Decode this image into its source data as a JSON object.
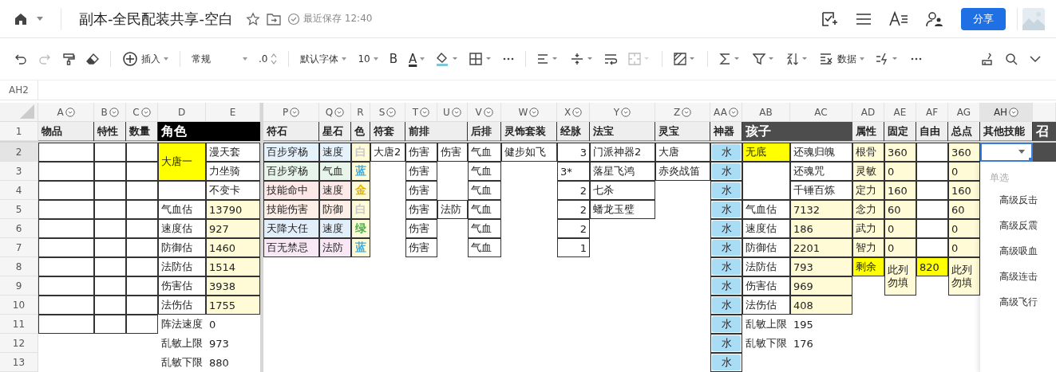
{
  "header": {
    "title": "副本-全民配装共享-空白",
    "save_status": "最近保存 12:40",
    "share": "分享"
  },
  "toolbar": {
    "redo": {
      "disabled": true
    },
    "insert": "插入",
    "number_format": "常规",
    "decimals": ".0",
    "font": "默认字体",
    "font_size": "10",
    "bold": "B",
    "font_color": "A",
    "merge": {
      "disabled": true
    },
    "data": "数据"
  },
  "name_box": "AH2",
  "columns": [
    {
      "letter": "A",
      "filter": true,
      "selected": false
    },
    {
      "letter": "B",
      "filter": true,
      "selected": false
    },
    {
      "letter": "C",
      "filter": true,
      "selected": false
    },
    {
      "letter": "D",
      "filter": false,
      "selected": false
    },
    {
      "letter": "E",
      "filter": false,
      "selected": false
    },
    {
      "letter": "P",
      "filter": true,
      "selected": false
    },
    {
      "letter": "Q",
      "filter": true,
      "selected": false
    },
    {
      "letter": "R",
      "filter": false,
      "selected": false
    },
    {
      "letter": "S",
      "filter": true,
      "selected": false
    },
    {
      "letter": "T",
      "filter": true,
      "selected": false
    },
    {
      "letter": "U",
      "filter": true,
      "selected": false
    },
    {
      "letter": "V",
      "filter": true,
      "selected": false
    },
    {
      "letter": "W",
      "filter": true,
      "selected": false
    },
    {
      "letter": "X",
      "filter": true,
      "selected": false
    },
    {
      "letter": "Y",
      "filter": true,
      "selected": false
    },
    {
      "letter": "Z",
      "filter": true,
      "selected": false
    },
    {
      "letter": "AA",
      "filter": true,
      "selected": false
    },
    {
      "letter": "AB",
      "filter": false,
      "selected": false
    },
    {
      "letter": "AC",
      "filter": false,
      "selected": false
    },
    {
      "letter": "AD",
      "filter": false,
      "selected": false
    },
    {
      "letter": "AE",
      "filter": false,
      "selected": false
    },
    {
      "letter": "AF",
      "filter": false,
      "selected": false
    },
    {
      "letter": "AG",
      "filter": false,
      "selected": false
    },
    {
      "letter": "AH",
      "filter": true,
      "selected": true
    },
    {
      "filter": false,
      "selected": false
    }
  ],
  "rows": [
    {
      "number": "1",
      "selected": false,
      "cells": [
        {
          "kind": "head",
          "text": "物品"
        },
        {
          "kind": "head",
          "text": "特性"
        },
        {
          "kind": "head",
          "text": "数量"
        },
        {
          "kind": "title",
          "text": "角色",
          "color": "#000000",
          "merged_across": true
        },
        {
          "kind": "head",
          "text": "符石"
        },
        {
          "kind": "head",
          "text": "星石"
        },
        {
          "kind": "head",
          "text": "色"
        },
        {
          "kind": "head",
          "text": "符套"
        },
        {
          "kind": "head",
          "text": "前排",
          "merged_across": true
        },
        {
          "kind": "head",
          "text": "后排"
        },
        {
          "kind": "head",
          "text": "灵饰套装"
        },
        {
          "kind": "head",
          "text": "经脉"
        },
        {
          "kind": "head",
          "text": "法宝"
        },
        {
          "kind": "head",
          "text": "灵宝"
        },
        {
          "kind": "head",
          "text": "神器"
        },
        {
          "kind": "title",
          "text": "孩子",
          "color": "#4d4d4d",
          "merged_across": true
        },
        {
          "kind": "head",
          "text": "属性"
        },
        {
          "kind": "head",
          "text": "固定"
        },
        {
          "kind": "head",
          "text": "自由"
        },
        {
          "kind": "head",
          "text": "总点"
        },
        {
          "kind": "head",
          "text": "其他技能"
        },
        {
          "kind": "title",
          "text": "召",
          "color": "#4d4d4d"
        }
      ]
    },
    {
      "number": "2",
      "selected": true,
      "cells": [
        {
          "kind": "cell"
        },
        {
          "kind": "cell"
        },
        {
          "kind": "cell"
        },
        {
          "kind": "cell",
          "text": "大唐一",
          "color": "#ffff00",
          "merged_down": true
        },
        {
          "kind": "cell",
          "text": "漫天套"
        },
        {
          "kind": "cell",
          "text": "百步穿杨",
          "color": "#e5f1fb"
        },
        {
          "kind": "cell",
          "text": "速度",
          "color": "#e5f1fb"
        },
        {
          "kind": "colored_text",
          "text": "白",
          "color": "#c8c8c8"
        },
        {
          "kind": "cell",
          "text": "大唐2"
        },
        {
          "kind": "cell",
          "text": "伤害"
        },
        {
          "kind": "cell",
          "text": "伤害"
        },
        {
          "kind": "cell",
          "text": "气血"
        },
        {
          "kind": "cell",
          "text": "健步如飞"
        },
        {
          "kind": "cell",
          "text": "3",
          "right_aligned": true
        },
        {
          "kind": "cell",
          "text": "门派神器2"
        },
        {
          "kind": "cell",
          "text": "大唐"
        },
        {
          "kind": "tag",
          "text": "水",
          "color": "#a9dcf5"
        },
        {
          "kind": "cell",
          "text": "无底",
          "color": "#ffff00"
        },
        {
          "kind": "cell",
          "text": "还魂归魄"
        },
        {
          "kind": "cell",
          "text": "根骨",
          "color": "#fffbd6"
        },
        {
          "kind": "cell",
          "text": "360",
          "color": "#fffbd6"
        },
        {
          "kind": "cell"
        },
        {
          "kind": "cell",
          "text": "360",
          "color": "#fffbd6"
        },
        {
          "kind": "select"
        },
        {
          "kind": "title",
          "color": "#4d4d4d"
        }
      ]
    },
    {
      "number": "3",
      "selected": false,
      "cells": [
        {
          "kind": "cell"
        },
        {
          "kind": "cell"
        },
        {
          "kind": "cell"
        },
        {
          "kind": "cell",
          "text": "力坐骑"
        },
        {
          "kind": "cell",
          "text": "百步穿杨",
          "color": "#e8f5ea"
        },
        {
          "kind": "cell",
          "text": "气血",
          "color": "#e8f5ea"
        },
        {
          "kind": "colored_text",
          "text": "蓝",
          "color": "#3fa9e0"
        },
        {
          "kind": "free"
        },
        {
          "kind": "cell",
          "text": "伤害"
        },
        {
          "kind": "free"
        },
        {
          "kind": "cell",
          "text": "气血"
        },
        {
          "kind": "free"
        },
        {
          "kind": "cell",
          "text": "3*"
        },
        {
          "kind": "cell",
          "text": "落星飞鸿"
        },
        {
          "kind": "cell",
          "text": "赤炎战笛"
        },
        {
          "kind": "tag",
          "text": "水",
          "color": "#a9dcf5"
        },
        {
          "kind": "cell",
          "merged_down": true
        },
        {
          "kind": "cell",
          "text": "还魂咒"
        },
        {
          "kind": "cell",
          "text": "灵敏",
          "color": "#fffbd6"
        },
        {
          "kind": "cell",
          "text": "0",
          "color": "#fffbd6"
        },
        {
          "kind": "cell"
        },
        {
          "kind": "cell",
          "text": "0",
          "color": "#fffbd6"
        }
      ]
    },
    {
      "number": "4",
      "selected": false,
      "cells": [
        {
          "kind": "cell"
        },
        {
          "kind": "cell"
        },
        {
          "kind": "cell"
        },
        {
          "kind": "cell"
        },
        {
          "kind": "cell",
          "text": "不变卡"
        },
        {
          "kind": "cell",
          "text": "技能命中",
          "color": "#fce8e6"
        },
        {
          "kind": "cell",
          "text": "速度",
          "color": "#fce8e6"
        },
        {
          "kind": "colored_text",
          "text": "金",
          "color": "#e6b400"
        },
        {
          "kind": "free"
        },
        {
          "kind": "cell",
          "text": "伤害"
        },
        {
          "kind": "free"
        },
        {
          "kind": "cell",
          "text": "气血"
        },
        {
          "kind": "free"
        },
        {
          "kind": "cell",
          "text": "2",
          "right_aligned": true
        },
        {
          "kind": "cell",
          "text": "七杀"
        },
        {
          "kind": "free"
        },
        {
          "kind": "tag",
          "text": "水",
          "color": "#a9dcf5"
        },
        {
          "kind": "cell",
          "text": "千锤百炼"
        },
        {
          "kind": "cell",
          "text": "定力",
          "color": "#fffbd6"
        },
        {
          "kind": "cell",
          "text": "160",
          "color": "#fffbd6"
        },
        {
          "kind": "cell"
        },
        {
          "kind": "cell",
          "text": "160",
          "color": "#fffbd6"
        }
      ]
    },
    {
      "number": "5",
      "selected": false,
      "cells": [
        {
          "kind": "cell"
        },
        {
          "kind": "cell"
        },
        {
          "kind": "cell"
        },
        {
          "kind": "cell",
          "text": "气血估"
        },
        {
          "kind": "cell",
          "text": "13790",
          "color": "#fffbd6"
        },
        {
          "kind": "cell",
          "text": "技能伤害",
          "color": "#fdeee8"
        },
        {
          "kind": "cell",
          "text": "防御",
          "color": "#fdeee8"
        },
        {
          "kind": "colored_text",
          "text": "白",
          "color": "#c8c8c8"
        },
        {
          "kind": "free"
        },
        {
          "kind": "cell",
          "text": "伤害"
        },
        {
          "kind": "cell",
          "text": "法防"
        },
        {
          "kind": "cell",
          "text": "气血"
        },
        {
          "kind": "free"
        },
        {
          "kind": "cell",
          "text": "2",
          "right_aligned": true
        },
        {
          "kind": "cell",
          "text": "蟠龙玉璧"
        },
        {
          "kind": "free"
        },
        {
          "kind": "tag",
          "text": "水",
          "color": "#a9dcf5"
        },
        {
          "kind": "cell",
          "text": "气血估"
        },
        {
          "kind": "cell",
          "text": "7132",
          "color": "#fffbd6"
        },
        {
          "kind": "cell",
          "text": "念力",
          "color": "#fffbd6"
        },
        {
          "kind": "cell",
          "text": "60",
          "color": "#fffbd6"
        },
        {
          "kind": "cell"
        },
        {
          "kind": "cell",
          "text": "60",
          "color": "#fffbd6"
        }
      ]
    },
    {
      "number": "6",
      "selected": false,
      "cells": [
        {
          "kind": "cell"
        },
        {
          "kind": "cell"
        },
        {
          "kind": "cell"
        },
        {
          "kind": "cell",
          "text": "速度估"
        },
        {
          "kind": "cell",
          "text": "927",
          "color": "#fffbd6"
        },
        {
          "kind": "cell",
          "text": "天降大任",
          "color": "#e3eefb"
        },
        {
          "kind": "cell",
          "text": "速度",
          "color": "#e3eefb"
        },
        {
          "kind": "colored_text",
          "text": "绿",
          "color": "#4caf50"
        },
        {
          "kind": "free"
        },
        {
          "kind": "cell",
          "text": "伤害"
        },
        {
          "kind": "free"
        },
        {
          "kind": "cell",
          "text": "气血"
        },
        {
          "kind": "free"
        },
        {
          "kind": "cell",
          "text": "2",
          "right_aligned": true
        },
        {
          "kind": "free"
        },
        {
          "kind": "free"
        },
        {
          "kind": "tag",
          "text": "水",
          "color": "#a9dcf5"
        },
        {
          "kind": "cell",
          "text": "速度估"
        },
        {
          "kind": "cell",
          "text": "186",
          "color": "#fffbd6"
        },
        {
          "kind": "cell",
          "text": "武力",
          "color": "#fffbd6"
        },
        {
          "kind": "cell",
          "text": "0",
          "color": "#fffbd6"
        },
        {
          "kind": "cell"
        },
        {
          "kind": "cell",
          "text": "0",
          "color": "#fffbd6"
        }
      ]
    },
    {
      "number": "7",
      "selected": false,
      "cells": [
        {
          "kind": "cell"
        },
        {
          "kind": "cell"
        },
        {
          "kind": "cell"
        },
        {
          "kind": "cell",
          "text": "防御估"
        },
        {
          "kind": "cell",
          "text": "1460",
          "color": "#fffbd6"
        },
        {
          "kind": "cell",
          "text": "百无禁忌",
          "color": "#f8e8f6"
        },
        {
          "kind": "cell",
          "text": "法防",
          "color": "#f8e8f6"
        },
        {
          "kind": "colored_text",
          "text": "蓝",
          "color": "#3fa9e0"
        },
        {
          "kind": "free"
        },
        {
          "kind": "cell",
          "text": "伤害"
        },
        {
          "kind": "free"
        },
        {
          "kind": "cell",
          "text": "气血"
        },
        {
          "kind": "free"
        },
        {
          "kind": "cell",
          "text": "1",
          "right_aligned": true
        },
        {
          "kind": "free"
        },
        {
          "kind": "free"
        },
        {
          "kind": "tag",
          "text": "水",
          "color": "#a9dcf5"
        },
        {
          "kind": "cell",
          "text": "防御估"
        },
        {
          "kind": "cell",
          "text": "2201",
          "color": "#fffbd6"
        },
        {
          "kind": "cell",
          "text": "智力",
          "color": "#fffbd6"
        },
        {
          "kind": "cell",
          "text": "0",
          "color": "#fffbd6"
        },
        {
          "kind": "cell"
        },
        {
          "kind": "cell",
          "text": "0",
          "color": "#fffbd6"
        }
      ]
    },
    {
      "number": "8",
      "selected": false,
      "cells": [
        {
          "kind": "cell"
        },
        {
          "kind": "cell"
        },
        {
          "kind": "cell"
        },
        {
          "kind": "cell",
          "text": "法防估"
        },
        {
          "kind": "cell",
          "text": "1514",
          "color": "#fffbd6"
        },
        {
          "kind": "free"
        },
        {
          "kind": "free"
        },
        {
          "kind": "free"
        },
        {
          "kind": "free"
        },
        {
          "kind": "free"
        },
        {
          "kind": "free"
        },
        {
          "kind": "free"
        },
        {
          "kind": "free"
        },
        {
          "kind": "free"
        },
        {
          "kind": "free"
        },
        {
          "kind": "free"
        },
        {
          "kind": "tag",
          "text": "水",
          "color": "#a9dcf5"
        },
        {
          "kind": "cell",
          "text": "法防估"
        },
        {
          "kind": "cell",
          "text": "793",
          "color": "#fffbd6"
        },
        {
          "kind": "cell",
          "text": "剩余",
          "color": "#ffff00"
        },
        {
          "kind": "cell",
          "text": "此列勿填",
          "color": "#fffbd6",
          "merged_down": true
        },
        {
          "kind": "cell",
          "text": "820",
          "color": "#ffff00"
        },
        {
          "kind": "cell",
          "text": "此列勿填",
          "color": "#fffbd6",
          "merged_down": true
        }
      ]
    },
    {
      "number": "9",
      "selected": false,
      "cells": [
        {
          "kind": "cell"
        },
        {
          "kind": "cell"
        },
        {
          "kind": "cell"
        },
        {
          "kind": "cell",
          "text": "伤害估"
        },
        {
          "kind": "cell",
          "text": "3938",
          "color": "#fffbd6"
        },
        {
          "kind": "free"
        },
        {
          "kind": "free"
        },
        {
          "kind": "free"
        },
        {
          "kind": "free"
        },
        {
          "kind": "free"
        },
        {
          "kind": "free"
        },
        {
          "kind": "free"
        },
        {
          "kind": "free"
        },
        {
          "kind": "free"
        },
        {
          "kind": "free"
        },
        {
          "kind": "free"
        },
        {
          "kind": "tag",
          "text": "水",
          "color": "#a9dcf5"
        },
        {
          "kind": "cell",
          "text": "伤害估"
        },
        {
          "kind": "cell",
          "text": "969",
          "color": "#fffbd6"
        }
      ]
    },
    {
      "number": "10",
      "selected": false,
      "cells": [
        {
          "kind": "cell"
        },
        {
          "kind": "cell"
        },
        {
          "kind": "cell"
        },
        {
          "kind": "cell",
          "text": "法伤估"
        },
        {
          "kind": "cell",
          "text": "1755",
          "color": "#fffbd6"
        },
        {
          "kind": "free"
        },
        {
          "kind": "free"
        },
        {
          "kind": "free"
        },
        {
          "kind": "free"
        },
        {
          "kind": "free"
        },
        {
          "kind": "free"
        },
        {
          "kind": "free"
        },
        {
          "kind": "free"
        },
        {
          "kind": "free"
        },
        {
          "kind": "free"
        },
        {
          "kind": "free"
        },
        {
          "kind": "tag",
          "text": "水",
          "color": "#a9dcf5"
        },
        {
          "kind": "cell",
          "text": "法伤估"
        },
        {
          "kind": "cell",
          "text": "408",
          "color": "#fffbd6"
        }
      ]
    },
    {
      "number": "11",
      "selected": false,
      "cells": [
        {
          "kind": "cell"
        },
        {
          "kind": "cell"
        },
        {
          "kind": "cell"
        },
        {
          "kind": "free",
          "text": "阵法速度"
        },
        {
          "kind": "free",
          "text": "0"
        },
        {
          "kind": "free"
        },
        {
          "kind": "free"
        },
        {
          "kind": "free"
        },
        {
          "kind": "free"
        },
        {
          "kind": "free"
        },
        {
          "kind": "free"
        },
        {
          "kind": "free"
        },
        {
          "kind": "free"
        },
        {
          "kind": "free"
        },
        {
          "kind": "free"
        },
        {
          "kind": "free"
        },
        {
          "kind": "tag",
          "text": "水",
          "color": "#a9dcf5"
        },
        {
          "kind": "free",
          "text": "乱敏上限"
        },
        {
          "kind": "free",
          "text": "195"
        }
      ]
    },
    {
      "number": "12",
      "selected": false,
      "cells": [
        {
          "kind": "free"
        },
        {
          "kind": "free"
        },
        {
          "kind": "free"
        },
        {
          "kind": "free",
          "text": "乱敏上限"
        },
        {
          "kind": "free",
          "text": "973"
        },
        {
          "kind": "free"
        },
        {
          "kind": "free"
        },
        {
          "kind": "free"
        },
        {
          "kind": "free"
        },
        {
          "kind": "free"
        },
        {
          "kind": "free"
        },
        {
          "kind": "free"
        },
        {
          "kind": "free"
        },
        {
          "kind": "free"
        },
        {
          "kind": "free"
        },
        {
          "kind": "free"
        },
        {
          "kind": "tag",
          "text": "水",
          "color": "#a9dcf5"
        },
        {
          "kind": "free",
          "text": "乱敏下限"
        },
        {
          "kind": "free",
          "text": "176"
        }
      ]
    },
    {
      "number": "13",
      "selected": false,
      "cells": [
        {
          "kind": "free"
        },
        {
          "kind": "free"
        },
        {
          "kind": "free"
        },
        {
          "kind": "free",
          "text": "乱敏下限"
        },
        {
          "kind": "free",
          "text": "880"
        },
        {
          "kind": "free"
        },
        {
          "kind": "free"
        },
        {
          "kind": "free"
        },
        {
          "kind": "free"
        },
        {
          "kind": "free"
        },
        {
          "kind": "free"
        },
        {
          "kind": "free"
        },
        {
          "kind": "free"
        },
        {
          "kind": "free"
        },
        {
          "kind": "free"
        },
        {
          "kind": "free"
        },
        {
          "kind": "tag",
          "text": "水",
          "color": "#a9dcf5"
        }
      ]
    }
  ],
  "dropdown": {
    "header": "单选",
    "items": [
      "高级反击",
      "高级反震",
      "高级吸血",
      "高级连击",
      "高级飞行"
    ]
  }
}
